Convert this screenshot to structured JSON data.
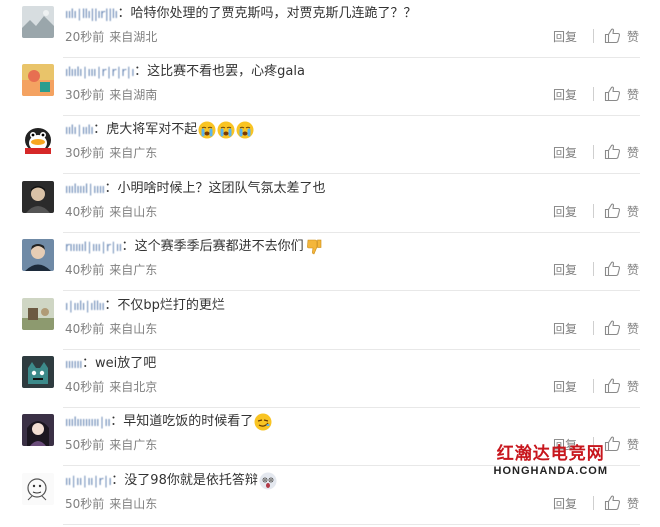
{
  "comments": [
    {
      "username": "ıılı∣llı||ır||lı",
      "text": "哈特你处理的了贾克斯吗，对贾克斯几连跪了？？",
      "time": "20秒前",
      "location": "来自湖北",
      "emoji": [],
      "avatar": "avatar-landscape"
    },
    {
      "username": "ılıılı∣ııı∣r∣r∣r∣ı",
      "text": "这比赛不看也罢，心疼gala",
      "time": "30秒前",
      "location": "来自湖南",
      "emoji": [],
      "avatar": "avatar-colorful"
    },
    {
      "username": "ıılı∣ıılı",
      "text": "虎大将军对不起",
      "time": "30秒前",
      "location": "来自广东",
      "emoji": [
        "crying-emoji",
        "crying-emoji",
        "crying-emoji"
      ],
      "avatar": "avatar-duck"
    },
    {
      "username": "ııılıııl∣ıııı",
      "text": "小明啥时候上？这团队气氛太差了也",
      "time": "40秒前",
      "location": "来自山东",
      "emoji": [],
      "avatar": "avatar-man"
    },
    {
      "username": "rıııııl∣ııı∣r∣ıı",
      "text": "这个赛季季后赛都进不去你们",
      "time": "40秒前",
      "location": "来自广东",
      "emoji": [
        "thumbs-down-emoji"
      ],
      "avatar": "avatar-portrait"
    },
    {
      "username": "ı∣ıılı∣ıllıı",
      "text": "不仅bp烂打的更烂",
      "time": "40秒前",
      "location": "来自山东",
      "emoji": [],
      "avatar": "avatar-scene"
    },
    {
      "username": "ıııııı",
      "text": "wei放了吧",
      "time": "40秒前",
      "location": "来自北京",
      "emoji": [],
      "avatar": "avatar-monster"
    },
    {
      "username": "ııılıııııııı∣ıı",
      "text": "早知道吃饭的时候看了",
      "time": "50秒前",
      "location": "来自广东",
      "emoji": [
        "smirk-emoji"
      ],
      "avatar": "avatar-girl"
    },
    {
      "username": "ıı∣ıı∣ıı∣r∣ı",
      "text": "没了98你就是依托答辩",
      "time": "50秒前",
      "location": "来自山东",
      "emoji": [
        "shock-emoji"
      ],
      "avatar": "avatar-sketch"
    }
  ],
  "actions": {
    "reply_label": "回复",
    "like_label": "赞"
  },
  "watermark": {
    "cn": "红瀚达电竞网",
    "en": "HONGHANDA.COM"
  },
  "colors": {
    "link": "#4a6fa5",
    "meta": "#808080",
    "watermark": "#c8161d"
  }
}
